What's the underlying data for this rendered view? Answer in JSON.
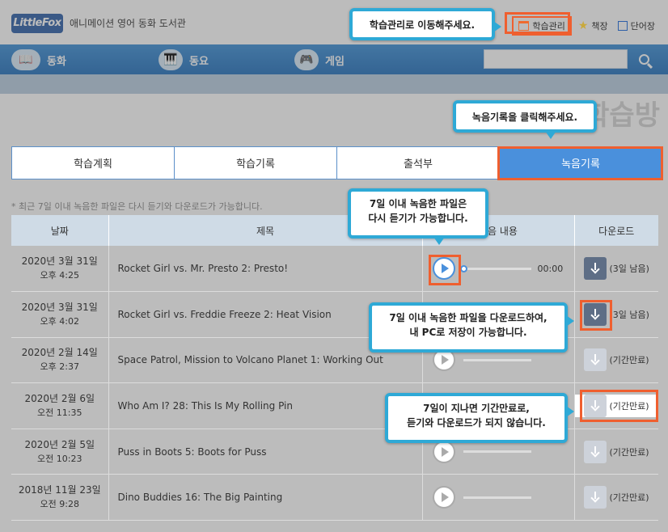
{
  "header": {
    "logo_text": "LittleFox",
    "site_title": "애니메이션 영어 동화 도서관",
    "util": [
      {
        "label": "학습관리",
        "icon": "calendar-icon"
      },
      {
        "label": "책장",
        "icon": "star-icon"
      },
      {
        "label": "단어장",
        "icon": "wordbook-icon"
      }
    ]
  },
  "nav": {
    "items": [
      {
        "label": "동화",
        "icon": "book-icon"
      },
      {
        "label": "동요",
        "icon": "piano-icon"
      },
      {
        "label": "게임",
        "icon": "gamepad-icon"
      }
    ],
    "search_placeholder": ""
  },
  "page": {
    "bg_title": "나의 학습방"
  },
  "tabs": [
    {
      "label": "학습계획",
      "active": false
    },
    {
      "label": "학습기록",
      "active": false
    },
    {
      "label": "출석부",
      "active": false
    },
    {
      "label": "녹음기록",
      "active": true
    }
  ],
  "notice": "* 최근 7일 이내 녹음한 파일은 다시 듣기와 다운로드가 가능합니다.",
  "table": {
    "headers": [
      "날짜",
      "제목",
      "녹음 내용",
      "다운로드"
    ],
    "rows": [
      {
        "date": "2020년 3월 31일",
        "time": "오후 4:25",
        "title": "Rocket Girl vs. Mr. Presto 2: Presto!",
        "player_time": "00:00",
        "dl_status": "(3일 남음)",
        "enabled": true
      },
      {
        "date": "2020년 3월 31일",
        "time": "오후 4:02",
        "title": "Rocket Girl vs. Freddie Freeze 2: Heat Vision",
        "player_time": "",
        "dl_status": "(3일 남음)",
        "enabled": true
      },
      {
        "date": "2020년 2월 14일",
        "time": "오후 2:37",
        "title": "Space Patrol, Mission to Volcano Planet 1: Working Out",
        "player_time": "",
        "dl_status": "(기간만료)",
        "enabled": false
      },
      {
        "date": "2020년 2월 6일",
        "time": "오전 11:35",
        "title": "Who Am I? 28: This Is My Rolling Pin",
        "player_time": "",
        "dl_status": "(기간만료)",
        "enabled": false
      },
      {
        "date": "2020년 2월 5일",
        "time": "오전 10:23",
        "title": "Puss in Boots 5: Boots for Puss",
        "player_time": "",
        "dl_status": "(기간만료)",
        "enabled": false
      },
      {
        "date": "2018년 11월 23일",
        "time": "오전 9:28",
        "title": "Dino Buddies 16: The Big Painting",
        "player_time": "",
        "dl_status": "(기간만료)",
        "enabled": false
      }
    ]
  },
  "callouts": {
    "c1": "학습관리로 이동해주세요.",
    "c2": "녹음기록을 클릭해주세요.",
    "c3_l1": "7일 이내 녹음한 파일은",
    "c3_l2": "다시 듣기가 가능합니다.",
    "c4_l1": "7일 이내 녹음한 파일을 다운로드하여,",
    "c4_l2": "내 PC로 저장이 가능합니다.",
    "c5_l1": "7일이 지나면 기간만료로,",
    "c5_l2": "듣기와 다운로드가 되지 않습니다."
  }
}
